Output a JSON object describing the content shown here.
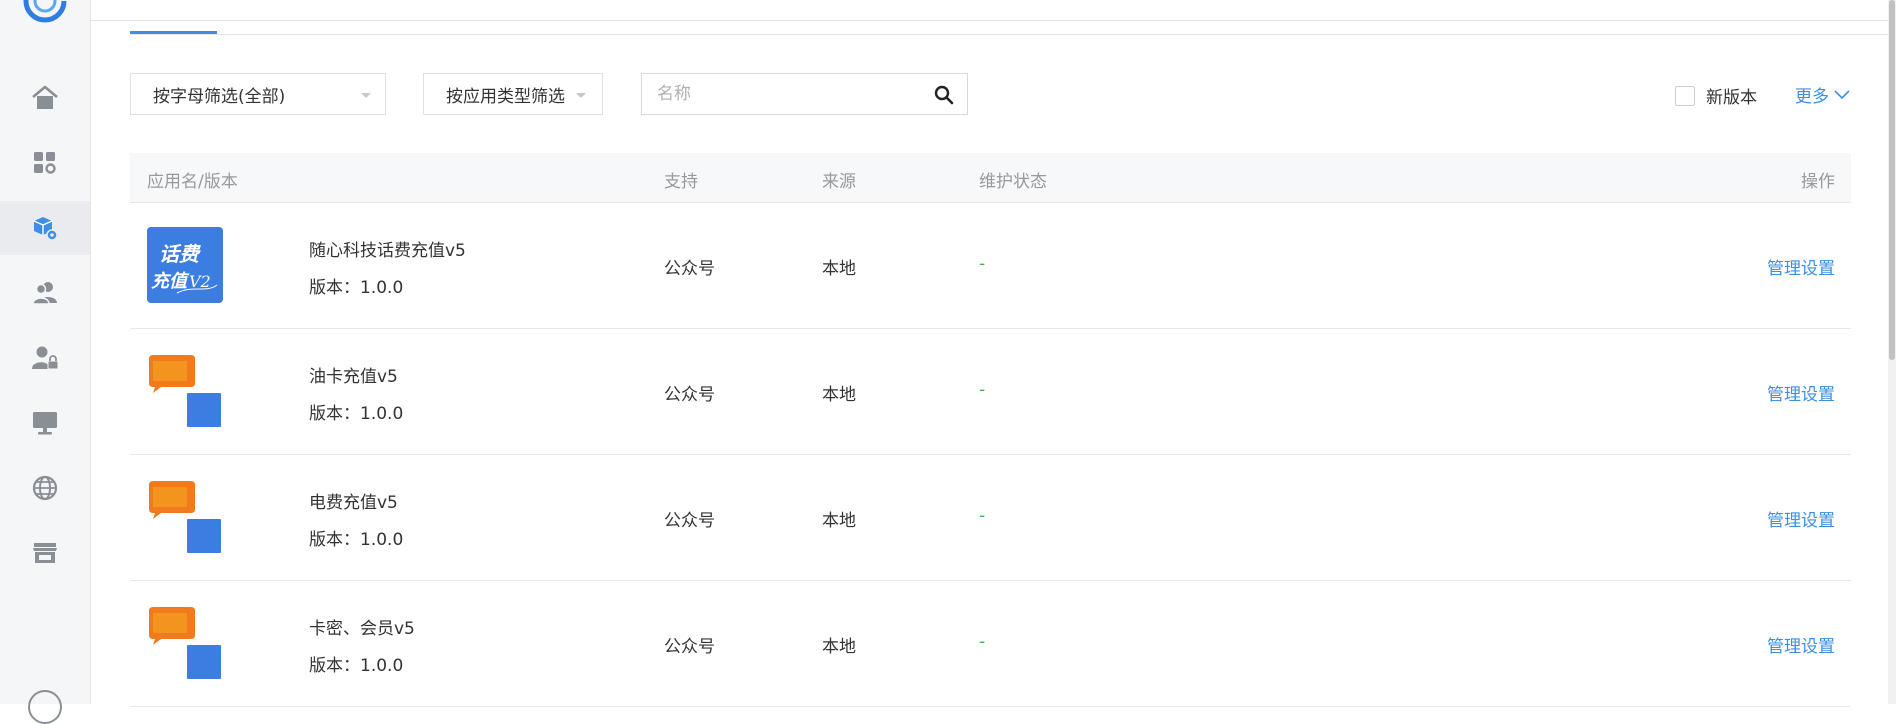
{
  "sidebar": {
    "items": [
      {
        "icon": "home-icon"
      },
      {
        "icon": "apps-icon"
      },
      {
        "icon": "package-settings-icon",
        "active": true
      },
      {
        "icon": "users-icon"
      },
      {
        "icon": "user-lock-icon"
      },
      {
        "icon": "monitor-icon"
      },
      {
        "icon": "globe-icon"
      },
      {
        "icon": "store-icon"
      }
    ]
  },
  "filters": {
    "letter": "按字母筛选(全部)",
    "type": "按应用类型筛选",
    "search_placeholder": "名称",
    "new_version_label": "新版本",
    "more_label": "更多"
  },
  "table": {
    "headers": {
      "name": "应用名/版本",
      "support": "支持",
      "source": "来源",
      "status": "维护状态",
      "action": "操作"
    },
    "rows": [
      {
        "name": "随心科技话费充值v5",
        "version": "版本：1.0.0",
        "support": "公众号",
        "source": "本地",
        "status": "-",
        "action": "管理设置"
      },
      {
        "name": "油卡充值v5",
        "version": "版本：1.0.0",
        "support": "公众号",
        "source": "本地",
        "status": "-",
        "action": "管理设置"
      },
      {
        "name": "电费充值v5",
        "version": "版本：1.0.0",
        "support": "公众号",
        "source": "本地",
        "status": "-",
        "action": "管理设置"
      },
      {
        "name": "卡密、会员v5",
        "version": "版本：1.0.0",
        "support": "公众号",
        "source": "本地",
        "status": "-",
        "action": "管理设置"
      }
    ]
  },
  "colors": {
    "accent": "#3c8fe4",
    "status_green": "#39b54a",
    "icon_blue": "#3b7de1",
    "icon_orange": "#f07a1c"
  }
}
